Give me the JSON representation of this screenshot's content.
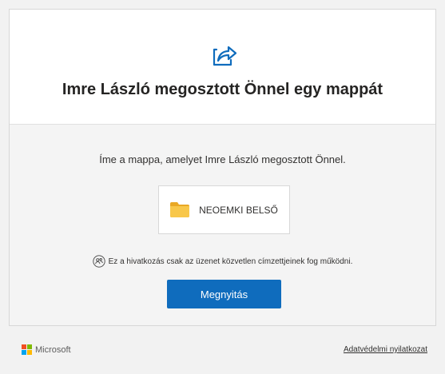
{
  "header": {
    "title": "Imre László megosztott Önnel egy mappát",
    "icon": "share-icon"
  },
  "main": {
    "subtitle": "Íme a mappa, amelyet Imre László megosztott Önnel.",
    "folder": {
      "name": "NEOEMKI BELSŐ",
      "icon": "folder-icon"
    },
    "notice": {
      "text": "Ez a hivatkozás csak az üzenet közvetlen címzettjeinek fog működni.",
      "icon": "people-icon"
    },
    "open_button_label": "Megnyitás"
  },
  "footer": {
    "brand": "Microsoft",
    "privacy_link": "Adatvédelmi nyilatkozat"
  },
  "colors": {
    "accent": "#0f6cbd",
    "folder": "#f8c74a",
    "ms_red": "#f25022",
    "ms_green": "#7fba00",
    "ms_blue": "#00a4ef",
    "ms_yellow": "#ffb900"
  }
}
